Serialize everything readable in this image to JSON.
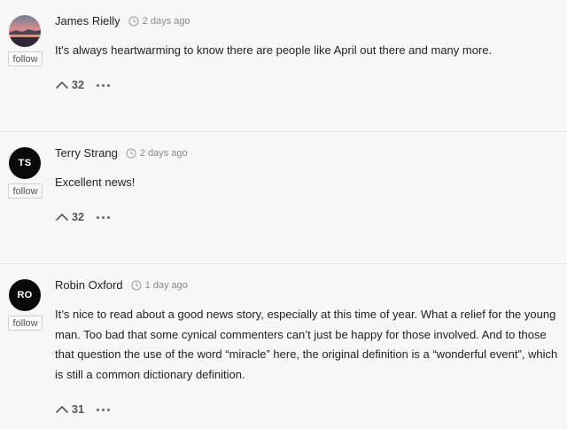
{
  "comments": [
    {
      "author": "James Rielly",
      "time": "2 days ago",
      "follow_label": "follow",
      "avatar": {
        "type": "photo",
        "icon": "sunset-landscape-photo"
      },
      "text": "It's always heartwarming to know there are people like April out there and many more.",
      "votes": "32"
    },
    {
      "author": "Terry Strang",
      "time": "2 days ago",
      "follow_label": "follow",
      "avatar": {
        "type": "initials",
        "initials": "TS"
      },
      "text": "Excellent news!",
      "votes": "32"
    },
    {
      "author": "Robin Oxford",
      "time": "1 day ago",
      "follow_label": "follow",
      "avatar": {
        "type": "initials",
        "initials": "RO"
      },
      "text": "It’s nice to read about a good news story, especially at this time of year. What a relief for the young man. Too bad that some cynical commenters can’t just be happy for those involved. And to those that question the use of the word “miracle” here, the original definition is a “wonderful event”, which is still a common dictionary definition.",
      "votes": "31"
    }
  ],
  "icons": {
    "time": "clock-icon",
    "upvote": "chevron-up-icon",
    "more": "more-dots-icon"
  },
  "colors": {
    "background": "#f7f7f7",
    "avatar_bg": "#0a0a0a",
    "divider": "#e3e3e3",
    "muted": "#8a8a8a"
  }
}
